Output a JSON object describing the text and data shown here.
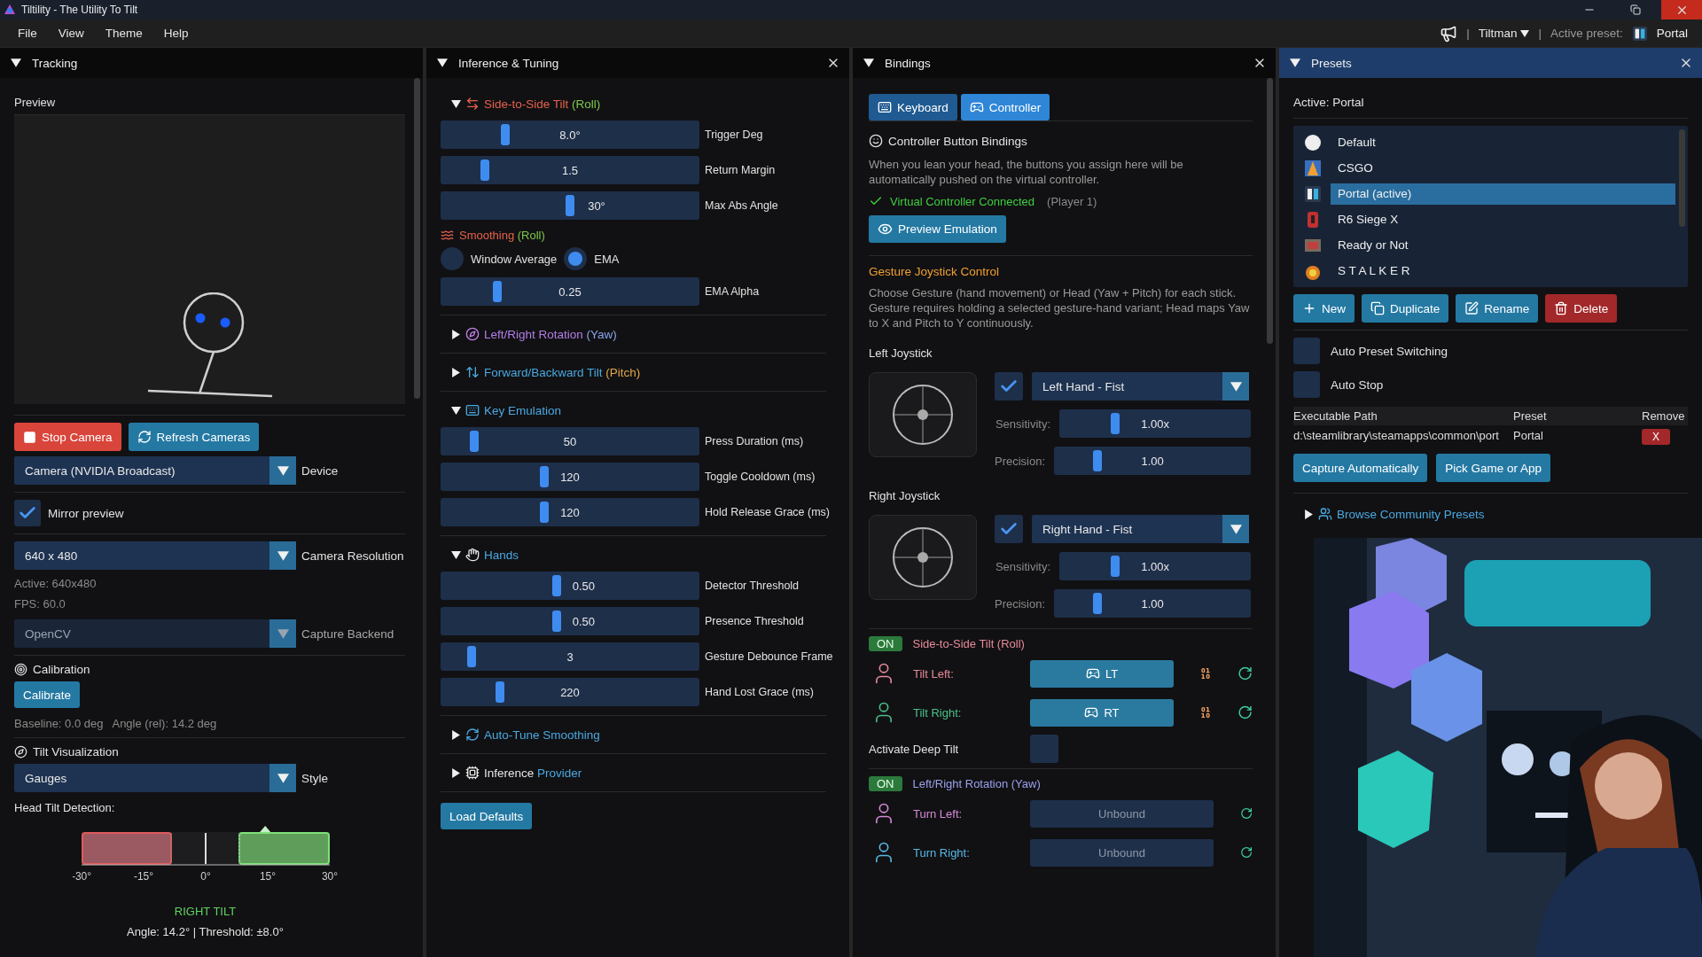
{
  "window": {
    "title": "Tiltility - The Utility To Tilt"
  },
  "menu": [
    "File",
    "View",
    "Theme",
    "Help"
  ],
  "header_bar": {
    "divider_1": "|",
    "user": "Tiltman",
    "divider_2": "|",
    "active_preset_label": "Active preset:",
    "active_preset": "Portal"
  },
  "tracking": {
    "title": "Tracking",
    "preview_label": "Preview",
    "buttons": [
      {
        "label": "Stop Camera",
        "kind": "stop"
      },
      {
        "label": "Refresh Cameras",
        "kind": "refresh"
      }
    ],
    "device": {
      "value": "Camera (NVIDIA Broadcast)",
      "label": "Device",
      "disabled": false
    },
    "mirror": {
      "label": "Mirror preview",
      "checked": true
    },
    "resolution": {
      "value": "640 x 480",
      "label": "Camera Resolution",
      "disabled": false
    },
    "info": [
      "Active: 640x480",
      "FPS: 60.0"
    ],
    "backend": {
      "value": "OpenCV",
      "label": "Capture Backend",
      "disabled": true
    },
    "calibration": {
      "title": "Calibration",
      "button": "Calibrate",
      "info": [
        "Baseline: 0.0 deg",
        "Angle (rel): 14.2 deg"
      ]
    },
    "visualization": {
      "title": "Tilt Visualization",
      "style": {
        "value": "Gauges",
        "label": "Style",
        "disabled": false
      }
    },
    "gauge": {
      "title": "Head Tilt Detection:",
      "ticks": [
        "-30°",
        "-15°",
        "0°",
        "15°",
        "30°"
      ],
      "level": 0.74,
      "status": "RIGHT TILT",
      "readout": "Angle: 14.2° | Threshold: ±8.0°"
    }
  },
  "inference": {
    "title": "Inference & Tuning",
    "sections": [
      {
        "kind": "roll",
        "parts": [
          {
            "text": "Side-to-Side Tilt",
            "color": "#e8604c"
          },
          {
            "text": "(Roll)",
            "color": "#7cc84c"
          }
        ],
        "expanded": true,
        "items": [
          {
            "kind": "slider",
            "value": "8.0°",
            "label": "Trigger Deg",
            "level": 0.25
          },
          {
            "kind": "slider",
            "value": "1.5",
            "label": "Return Margin",
            "level": 0.17
          },
          {
            "kind": "slider",
            "value": "30°",
            "label": "Max Abs Angle",
            "level": 0.5
          },
          {
            "kind": "heading",
            "parts": [
              {
                "text": "Smoothing",
                "color": "#e8604c"
              },
              {
                "text": "(Roll)",
                "color": "#7cc84c"
              }
            ]
          },
          {
            "kind": "radio",
            "options": [
              {
                "label": "Window Average",
                "selected": false
              },
              {
                "label": "EMA",
                "selected": true
              }
            ]
          },
          {
            "kind": "slider",
            "value": "0.25",
            "label": "EMA Alpha",
            "level": 0.22
          }
        ]
      },
      {
        "kind": "yaw",
        "parts": [
          {
            "text": "Left/Right Rotation",
            "color": "#b47ee8"
          },
          {
            "text": "(Yaw)",
            "color": "#8aa4ec"
          }
        ],
        "expanded": false
      },
      {
        "kind": "pitch",
        "parts": [
          {
            "text": "Forward/Backward Tilt",
            "color": "#4aa8e0"
          },
          {
            "text": "(Pitch)",
            "color": "#e0a84a"
          }
        ],
        "expanded": false
      },
      {
        "kind": "keys",
        "parts": [
          {
            "text": "Key Emulation",
            "color": "#4aa8e0"
          }
        ],
        "expanded": true,
        "items": [
          {
            "kind": "slider",
            "value": "50",
            "label": "Press Duration (ms)",
            "level": 0.13
          },
          {
            "kind": "slider",
            "value": "120",
            "label": "Toggle Cooldown (ms)",
            "level": 0.4
          },
          {
            "kind": "slider",
            "value": "120",
            "label": "Hold Release Grace (ms)",
            "level": 0.4
          }
        ]
      },
      {
        "kind": "hands",
        "parts": [
          {
            "text": "Hands",
            "color": "#4aa8e0"
          }
        ],
        "expanded": true,
        "items": [
          {
            "kind": "slider",
            "value": "0.50",
            "label": "Detector Threshold",
            "level": 0.45
          },
          {
            "kind": "slider",
            "value": "0.50",
            "label": "Presence Threshold",
            "level": 0.45
          },
          {
            "kind": "slider",
            "value": "3",
            "label": "Gesture Debounce Frame",
            "level": 0.12
          },
          {
            "kind": "slider",
            "value": "220",
            "label": "Hand Lost Grace (ms)",
            "level": 0.23
          }
        ]
      },
      {
        "kind": "autotune",
        "parts": [
          {
            "text": "Auto-Tune Smoothing",
            "color": "#4aa8e0"
          }
        ],
        "expanded": false
      },
      {
        "kind": "provider",
        "parts": [
          {
            "text": "Inference",
            "color": "#e6e6e6"
          },
          {
            "text": "Provider",
            "color": "#4aa8e0"
          }
        ],
        "expanded": false
      }
    ],
    "load_defaults": "Load Defaults"
  },
  "bindings": {
    "title": "Bindings",
    "tabs": [
      {
        "label": "Keyboard",
        "selected": false
      },
      {
        "label": "Controller",
        "selected": true
      }
    ],
    "heading": "Controller Button Bindings",
    "description": "When you lean your head, the buttons you assign here will be automatically pushed on the virtual controller.",
    "status": {
      "text": "Virtual Controller Connected",
      "detail": "(Player 1)",
      "connected": true
    },
    "preview_button": "Preview Emulation",
    "gesture_title": "Gesture Joystick Control",
    "gesture_description": "Choose Gesture (hand movement) or Head (Yaw + Pitch) for each stick. Gesture requires holding a selected gesture-hand variant; Head maps Yaw to X and Pitch to Y continuously.",
    "joysticks": [
      {
        "title": "Left Joystick",
        "enabled": true,
        "mode": "Left Hand - Fist",
        "sliders": [
          {
            "label": "Sensitivity:",
            "value": "1.00x",
            "level": 0.29
          },
          {
            "label": "Precision:",
            "value": "1.00",
            "level": 0.22
          }
        ]
      },
      {
        "title": "Right Joystick",
        "enabled": true,
        "mode": "Right Hand - Fist",
        "sliders": [
          {
            "label": "Sensitivity:",
            "value": "1.00x",
            "level": 0.29
          },
          {
            "label": "Precision:",
            "value": "1.00",
            "level": 0.22
          }
        ]
      }
    ],
    "groups": [
      {
        "on": true,
        "badge": "ON",
        "title": "Side-to-Side Tilt (Roll)",
        "color": "#e88a9a",
        "actions": [
          {
            "label": "Tilt Left:",
            "binding": "LT",
            "bound": true,
            "color": "#e88a9a"
          },
          {
            "label": "Tilt Right:",
            "binding": "RT",
            "bound": true,
            "color": "#4cc08a"
          }
        ],
        "deep_tilt": {
          "label": "Activate Deep Tilt",
          "checked": false
        }
      },
      {
        "on": true,
        "badge": "ON",
        "title": "Left/Right Rotation (Yaw)",
        "color": "#9aa0ec",
        "actions": [
          {
            "label": "Turn Left:",
            "binding": "Unbound",
            "bound": false,
            "color": "#d68ad8"
          },
          {
            "label": "Turn Right:",
            "binding": "Unbound",
            "bound": false,
            "color": "#5ab8e8"
          }
        ]
      }
    ]
  },
  "presets": {
    "title": "Presets",
    "active": "Active: Portal",
    "items": [
      {
        "name": "Default",
        "selected": false
      },
      {
        "name": "CSGO",
        "selected": false
      },
      {
        "name": "Portal (active)",
        "selected": true
      },
      {
        "name": "R6 Siege X",
        "selected": false
      },
      {
        "name": "Ready or Not",
        "selected": false
      },
      {
        "name": "S T A L K E R",
        "selected": false
      }
    ],
    "buttons": [
      {
        "label": "New",
        "kind": "new"
      },
      {
        "label": "Duplicate",
        "kind": "duplicate"
      },
      {
        "label": "Rename",
        "kind": "rename"
      },
      {
        "label": "Delete",
        "kind": "delete"
      }
    ],
    "toggles": [
      {
        "label": "Auto Preset Switching",
        "checked": false
      },
      {
        "label": "Auto Stop",
        "checked": false
      }
    ],
    "table": {
      "columns": [
        "Executable Path",
        "Preset",
        "Remove"
      ],
      "rows": [
        {
          "path": "d:\\steamlibrary\\steamapps\\common\\port",
          "preset": "Portal",
          "remove": "X"
        }
      ]
    },
    "actions": [
      "Capture Automatically",
      "Pick Game or App"
    ],
    "community": {
      "title": "Browse Community Presets",
      "expanded": false
    },
    "banner": {
      "kind": "picture"
    }
  }
}
